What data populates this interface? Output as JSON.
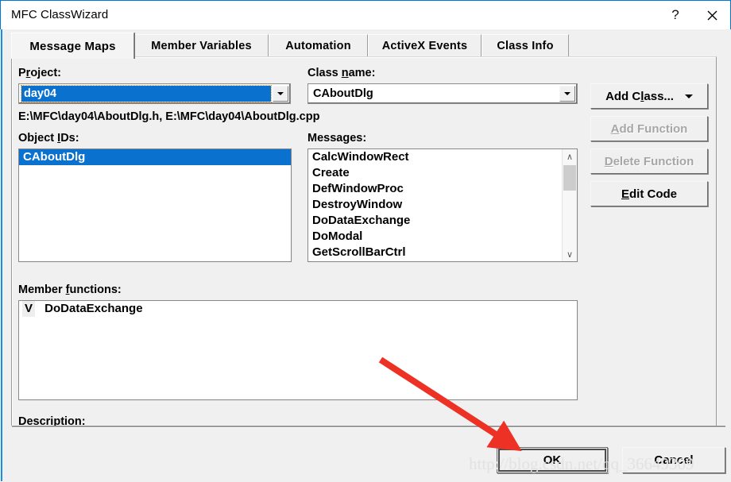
{
  "window": {
    "title": "MFC ClassWizard",
    "help_button": "?",
    "close_button": "close-icon"
  },
  "tabs": [
    {
      "label": "Message Maps",
      "active": true
    },
    {
      "label": "Member Variables",
      "active": false
    },
    {
      "label": "Automation",
      "active": false
    },
    {
      "label": "ActiveX Events",
      "active": false
    },
    {
      "label": "Class Info",
      "active": false
    }
  ],
  "project": {
    "label_pre": "P",
    "label_accel": "r",
    "label_post": "oject:",
    "value": "day04"
  },
  "class_name": {
    "label_pre": "Class ",
    "label_accel": "n",
    "label_post": "ame:",
    "value": "CAboutDlg"
  },
  "file_path": "E:\\MFC\\day04\\AboutDlg.h, E:\\MFC\\day04\\AboutDlg.cpp",
  "object_ids": {
    "label_pre": "Object ",
    "label_accel": "I",
    "label_post": "Ds:",
    "items": [
      {
        "label": "CAboutDlg",
        "selected": true
      }
    ]
  },
  "messages": {
    "label": "Messages:",
    "items": [
      {
        "label": "CalcWindowRect",
        "selected": false
      },
      {
        "label": "Create",
        "selected": false
      },
      {
        "label": "DefWindowProc",
        "selected": false
      },
      {
        "label": "DestroyWindow",
        "selected": false
      },
      {
        "label": "DoDataExchange",
        "selected": false
      },
      {
        "label": "DoModal",
        "selected": false
      },
      {
        "label": "GetScrollBarCtrl",
        "selected": false
      }
    ],
    "scrollbar": {
      "up": "∧",
      "down": "∨"
    }
  },
  "side_buttons": [
    {
      "label": "Add C",
      "accel": "l",
      "label_post": "ass...",
      "enabled": true,
      "dropdown": true
    },
    {
      "label": "",
      "accel": "A",
      "label_post": "dd Function",
      "enabled": false,
      "dropdown": false
    },
    {
      "label": "",
      "accel": "D",
      "label_post": "elete Function",
      "enabled": false,
      "dropdown": false
    },
    {
      "label": "",
      "accel": "E",
      "label_post": "dit Code",
      "enabled": true,
      "dropdown": false
    }
  ],
  "member_functions": {
    "label_pre": "Member ",
    "label_accel": "f",
    "label_post": "unctions:",
    "items": [
      {
        "mark": "V",
        "label": "DoDataExchange"
      }
    ]
  },
  "description": {
    "label": "Description:",
    "text": ""
  },
  "footer_buttons": {
    "ok": "OK",
    "cancel": "Cancel"
  },
  "watermark": "http://blog.csdn.net/qq_36649309",
  "colors": {
    "selection_blue": "#0b71ce",
    "title_accent": "#0078d7",
    "annotation_red": "#ed3124",
    "face": "#f0f0f0"
  }
}
